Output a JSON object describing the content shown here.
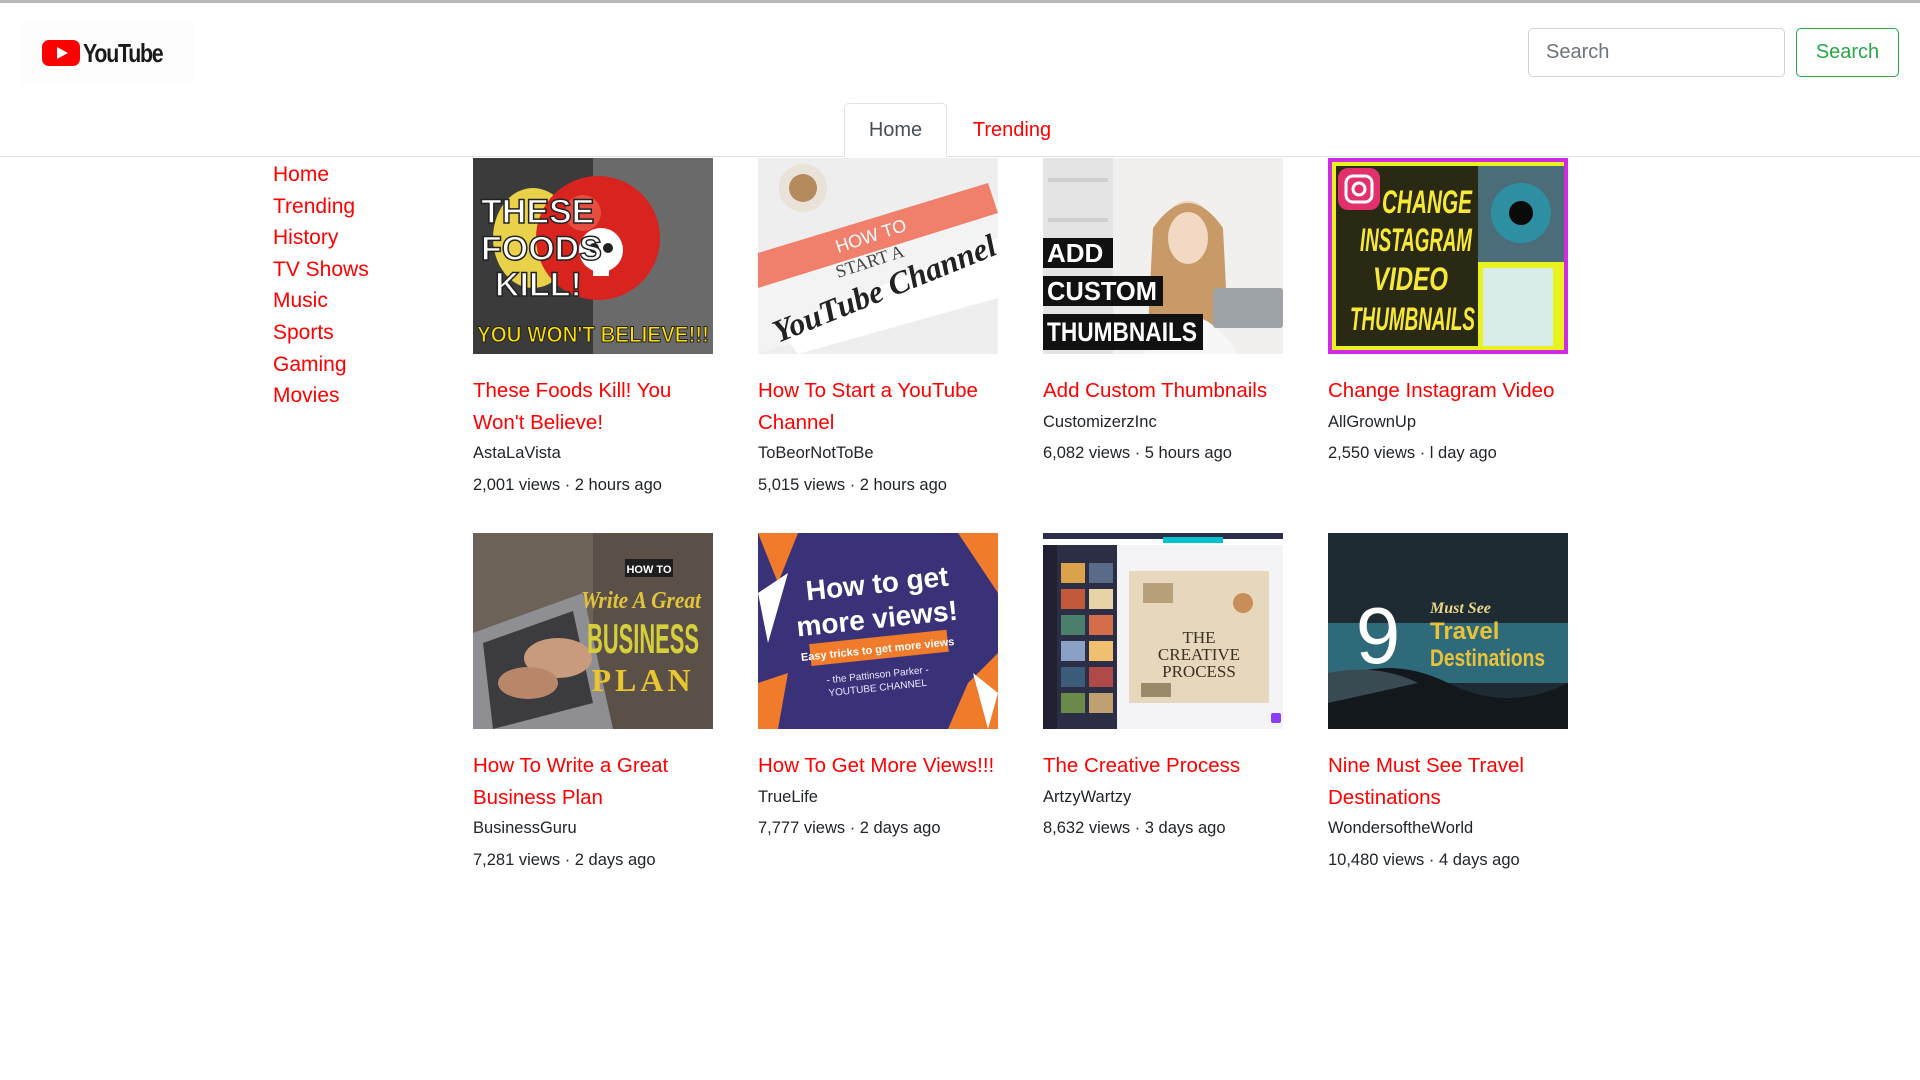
{
  "header": {
    "logo_text": "YouTube",
    "search_placeholder": "Search",
    "search_button": "Search"
  },
  "tabs": [
    {
      "label": "Home",
      "active": true
    },
    {
      "label": "Trending",
      "active": false
    }
  ],
  "sidebar": {
    "items": [
      {
        "label": "Home"
      },
      {
        "label": "Trending"
      },
      {
        "label": "History"
      },
      {
        "label": "TV Shows"
      },
      {
        "label": "Music"
      },
      {
        "label": "Sports"
      },
      {
        "label": "Gaming"
      },
      {
        "label": "Movies"
      }
    ]
  },
  "videos": [
    {
      "title": "These Foods Kill! You Won't Believe!",
      "channel": "AstaLaVista",
      "meta": "2,001 views · 2 hours ago",
      "thumb_text": [
        "THESE",
        "FOODS",
        "KILL!",
        "YOU WON'T BELIEVE!!!"
      ]
    },
    {
      "title": "How To Start a YouTube Channel",
      "channel": "ToBeorNotToBe",
      "meta": "5,015 views · 2 hours ago",
      "thumb_text": [
        "HOW TO",
        "START A",
        "YouTube Channel"
      ]
    },
    {
      "title": "Add Custom Thumbnails",
      "channel": "CustomizerzInc",
      "meta": "6,082 views · 5 hours ago",
      "thumb_text": [
        "ADD",
        "CUSTOM",
        "THUMBNAILS"
      ]
    },
    {
      "title": "Change Instagram Video",
      "channel": "AllGrownUp",
      "meta": "2,550 views · l day ago",
      "thumb_text": [
        "CHANGE",
        "INSTAGRAM",
        "VIDEO",
        "THUMBNAILS"
      ]
    },
    {
      "title": "How To Write a Great Business Plan",
      "channel": "BusinessGuru",
      "meta": "7,281 views · 2 days ago",
      "thumb_text": [
        "HOW TO",
        "Write A Great",
        "BUSINESS",
        "PLAN"
      ]
    },
    {
      "title": "How To Get More Views!!!",
      "channel": "TrueLife",
      "meta": "7,777 views · 2 days ago",
      "thumb_text": [
        "How to get",
        "more views!",
        "Easy tricks to get more views",
        "- the Pattinson Parker -",
        "YOUTUBE CHANNEL"
      ]
    },
    {
      "title": "The Creative Process",
      "channel": "ArtzyWartzy",
      "meta": "8,632 views · 3 days ago",
      "thumb_text": [
        "THE",
        "CREATIVE",
        "PROCESS"
      ]
    },
    {
      "title": "Nine Must See Travel Destinations",
      "channel": "WondersoftheWorld",
      "meta": "10,480 views · 4 days ago",
      "thumb_text": [
        "9",
        "Must See",
        "Travel",
        "Destinations"
      ]
    }
  ],
  "colors": {
    "accent": "#ff0000",
    "search_button": "#28a745",
    "text": "#212529",
    "tab_text": "#495057",
    "border": "#dee2e6"
  }
}
